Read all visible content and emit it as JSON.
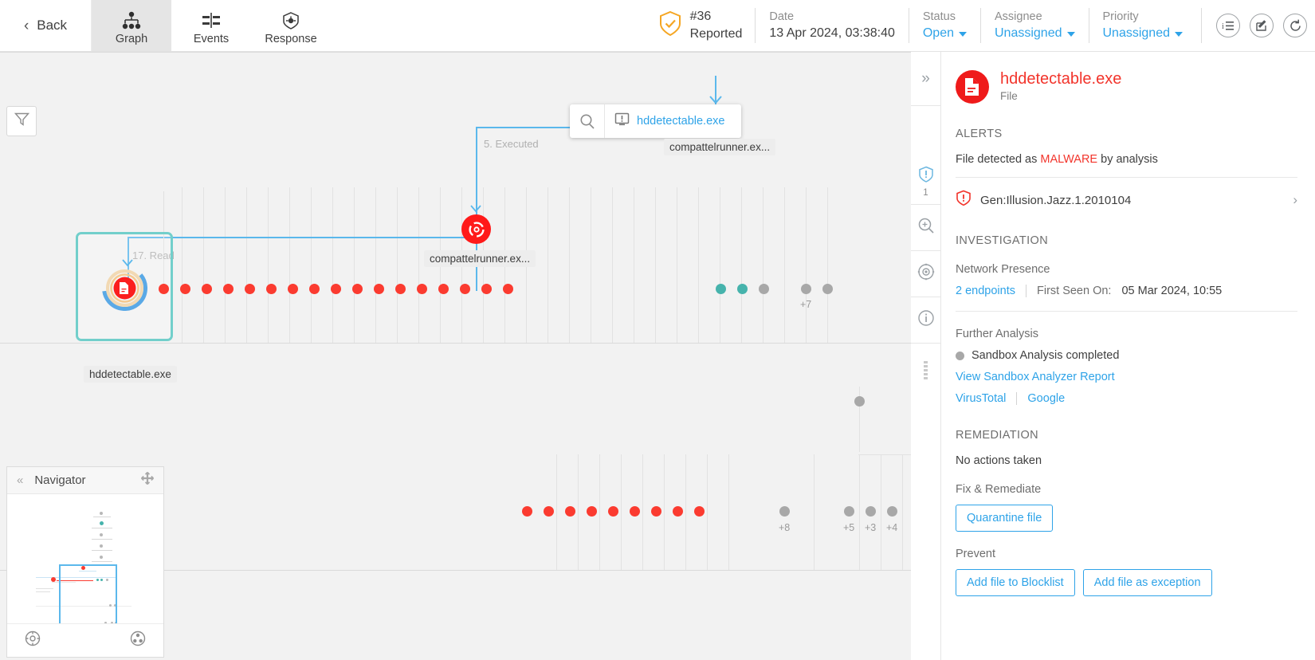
{
  "topbar": {
    "back_label": "Back",
    "tabs": [
      {
        "label": "Graph",
        "icon": "hierarchy-icon",
        "active": true
      },
      {
        "label": "Events",
        "icon": "events-icon",
        "active": false
      },
      {
        "label": "Response",
        "icon": "shield-response-icon",
        "active": false
      }
    ],
    "incident": {
      "id": "#36",
      "state": "Reported",
      "icon": "shield-check-icon"
    },
    "date": {
      "label": "Date",
      "value": "13 Apr 2024, 03:38:40"
    },
    "status": {
      "label": "Status",
      "value": "Open"
    },
    "assignee": {
      "label": "Assignee",
      "value": "Unassigned"
    },
    "priority": {
      "label": "Priority",
      "value": "Unassigned"
    },
    "actions": [
      {
        "name": "details-list-icon",
        "glyph": "i≡"
      },
      {
        "name": "edit-note-icon",
        "glyph": "✎"
      },
      {
        "name": "refresh-icon",
        "glyph": "⟳"
      }
    ]
  },
  "graph": {
    "filter_icon": "filter-icon",
    "tooltip": {
      "search_icon": "magnifier-icon",
      "endpoint_icon": "endpoint-alert-icon",
      "endpoint_name": "hddetectable.exe"
    },
    "edge_labels": [
      {
        "text": "5. Executed"
      },
      {
        "text": "17. Read"
      }
    ],
    "node_labels": [
      {
        "text": "compattelrunner.ex..."
      },
      {
        "text": "compattelrunner.ex..."
      },
      {
        "text": "hddetectable.exe"
      }
    ],
    "cluster_counts": [
      "+7",
      "+8",
      "+5",
      "+3",
      "+4"
    ],
    "legend_colors": {
      "malicious": "#fb3b30",
      "network": "#46b3ac",
      "neutral": "#a8a8a8",
      "edge": "#5bb8ec",
      "selection": "#72cfcb"
    }
  },
  "navigator": {
    "title": "Navigator",
    "collapse_icon": "double-chevron-left-icon",
    "move_icon": "move-icon",
    "fit_icon": "fit-to-screen-icon",
    "center_icon": "center-graph-icon"
  },
  "rail": {
    "expand_icon": "double-chevron-right-icon",
    "items": [
      {
        "name": "alerts-icon",
        "count": "1"
      },
      {
        "name": "investigate-icon",
        "count": ""
      },
      {
        "name": "target-icon",
        "count": ""
      },
      {
        "name": "info-icon",
        "count": ""
      }
    ]
  },
  "panel": {
    "file_name": "hddetectable.exe",
    "file_type": "File",
    "file_icon": "document-icon",
    "alerts": {
      "heading": "ALERTS",
      "summary_prefix": "File detected as ",
      "summary_highlight": "MALWARE",
      "summary_suffix": " by analysis",
      "items": [
        {
          "icon": "shield-alert-icon",
          "name": "Gen:Illusion.Jazz.1.2010104",
          "chevron": "›"
        }
      ]
    },
    "investigation": {
      "heading": "INVESTIGATION",
      "network_presence_label": "Network Presence",
      "endpoints_link": "2 endpoints",
      "first_seen_label": "First Seen On:",
      "first_seen_value": "05 Mar 2024, 10:55",
      "further_analysis_label": "Further Analysis",
      "sandbox_status": "Sandbox Analysis completed",
      "sandbox_report_link": "View Sandbox Analyzer Report",
      "virustotal_link": "VirusTotal",
      "google_link": "Google"
    },
    "remediation": {
      "heading": "REMEDIATION",
      "no_actions": "No actions taken",
      "fix_label": "Fix & Remediate",
      "quarantine_btn": "Quarantine file",
      "prevent_label": "Prevent",
      "blocklist_btn": "Add file to Blocklist",
      "exception_btn": "Add file as exception"
    }
  }
}
